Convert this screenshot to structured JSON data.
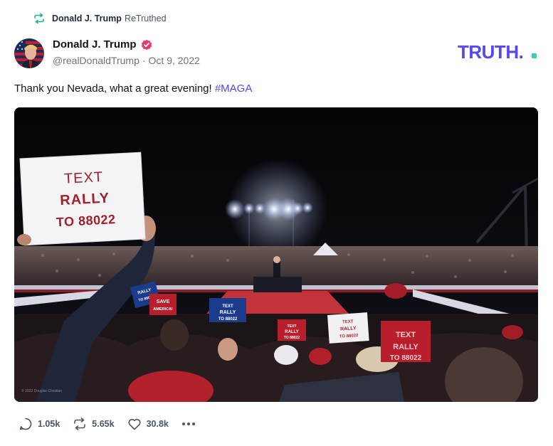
{
  "retruth": {
    "icon": "retruth-icon",
    "name": "Donald J. Trump",
    "action": "ReTruthed"
  },
  "author": {
    "display_name": "Donald J. Trump",
    "verified_icon": "verified-badge-icon",
    "handle": "@realDonaldTrump",
    "separator": "·",
    "date": "Oct 9, 2022"
  },
  "brand": {
    "logo_text": "TRUTH.",
    "logo_color": "#5448ee",
    "dot_color": "#33d1c1"
  },
  "post": {
    "text": "Thank you Nevada, what a great evening! ",
    "hashtag": "#MAGA",
    "image": {
      "sign_main_line1": "TEXT",
      "sign_main_line2": "RALLY",
      "sign_main_line3": "TO 88022",
      "sign_small_text": "TEXT",
      "sign_small_rally": "RALLY",
      "sign_small_number": "TO 88022",
      "sign_save": "SAVE",
      "sign_america": "AMERICA!",
      "photo_credit": "© 2022 Douglas Christian"
    }
  },
  "actions": {
    "reply": {
      "icon": "reply-icon",
      "count": "1.05k"
    },
    "retruth": {
      "icon": "retruth-icon",
      "count": "5.65k"
    },
    "like": {
      "icon": "heart-icon",
      "count": "30.8k"
    },
    "more": {
      "icon": "more-icon",
      "label": "•••"
    }
  },
  "colors": {
    "accent": "#5448ee",
    "text": "#0f1419",
    "muted": "#6b7280"
  }
}
